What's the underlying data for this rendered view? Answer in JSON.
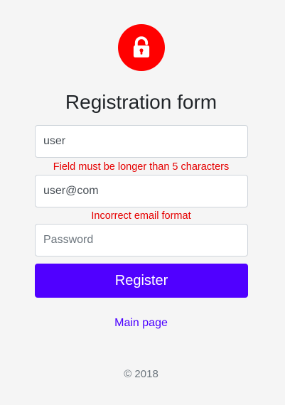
{
  "form": {
    "title": "Registration form",
    "username": {
      "value": "user",
      "error": "Field must be longer than 5 characters"
    },
    "email": {
      "value": "user@com",
      "error": "Incorrect email format"
    },
    "password": {
      "value": "",
      "placeholder": "Password"
    },
    "register_label": "Register"
  },
  "links": {
    "main_page": "Main page"
  },
  "footer": {
    "copyright": "© 2018"
  },
  "icons": {
    "lock": "lock-icon"
  },
  "colors": {
    "lock_background": "#ff0000",
    "primary_button": "#5000ff",
    "link": "#4b00ff",
    "error": "#e60000",
    "page_background": "#f5f5f5"
  }
}
